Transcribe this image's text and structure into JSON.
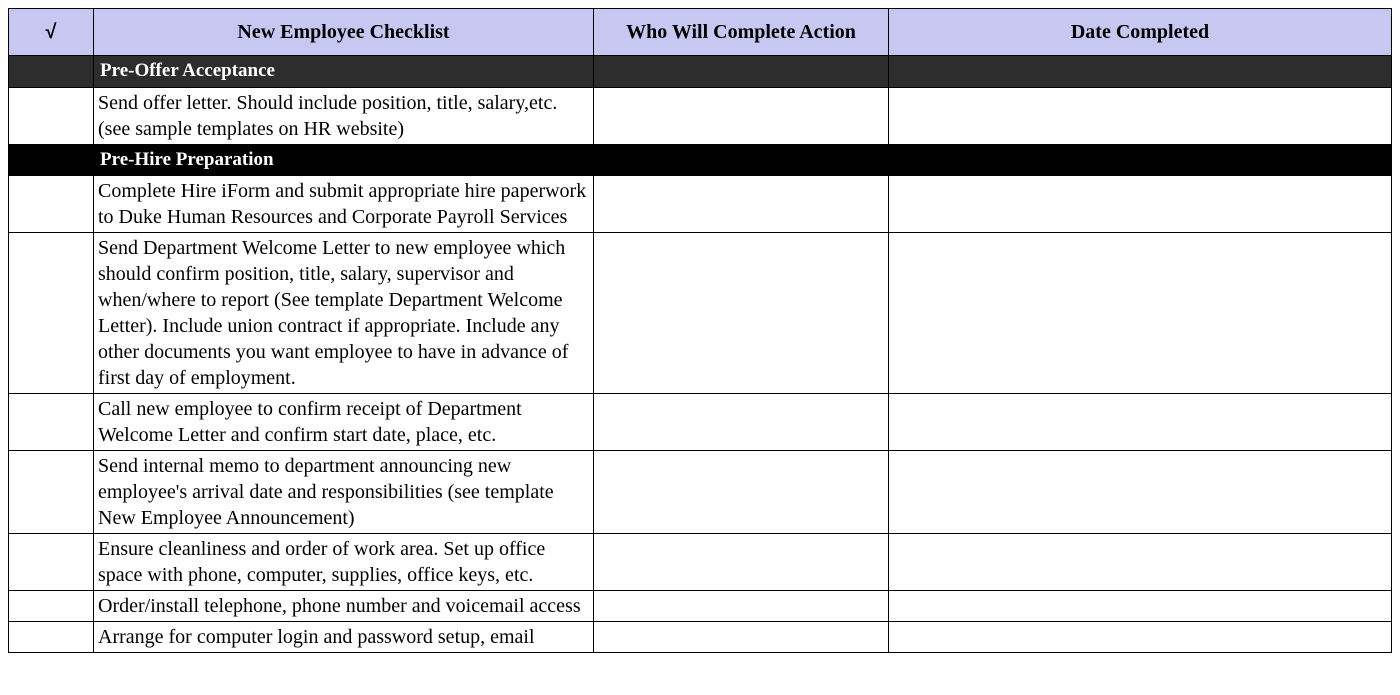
{
  "headers": {
    "check": "√",
    "task": "New Employee Checklist",
    "who": "Who Will Complete Action",
    "date": "Date Completed"
  },
  "section1": {
    "title": "Pre-Offer Acceptance",
    "rows": [
      {
        "task": "Send offer letter. Should include position, title, salary,etc. (see sample templates on HR website)",
        "check": "",
        "who": "",
        "date": ""
      }
    ]
  },
  "section2": {
    "title": "Pre-Hire Preparation",
    "rows": [
      {
        "task": "Complete Hire iForm and submit appropriate hire paperwork to Duke Human Resources and Corporate Payroll Services",
        "check": "",
        "who": "",
        "date": ""
      },
      {
        "task": "Send Department Welcome Letter to new employee which should confirm position, title, salary, supervisor and when/where to report (See template Department Welcome Letter). Include union contract if appropriate. Include any other documents you want employee to have in advance of first day of employment.",
        "check": "",
        "who": "",
        "date": ""
      },
      {
        "task": "Call new employee to confirm receipt of Department Welcome Letter and confirm start date, place, etc.",
        "check": "",
        "who": "",
        "date": ""
      },
      {
        "task": "Send internal memo to department announcing new employee's arrival date and responsibilities (see template New Employee Announcement)",
        "check": "",
        "who": "",
        "date": ""
      },
      {
        "task": "Ensure cleanliness and order of work area. Set up office space with phone, computer, supplies, office keys, etc.",
        "check": "",
        "who": "",
        "date": ""
      },
      {
        "task": "Order/install telephone, phone number and voicemail access",
        "check": "",
        "who": "",
        "date": ""
      },
      {
        "task": "Arrange for computer login and password setup, email",
        "check": "",
        "who": "",
        "date": ""
      }
    ]
  }
}
